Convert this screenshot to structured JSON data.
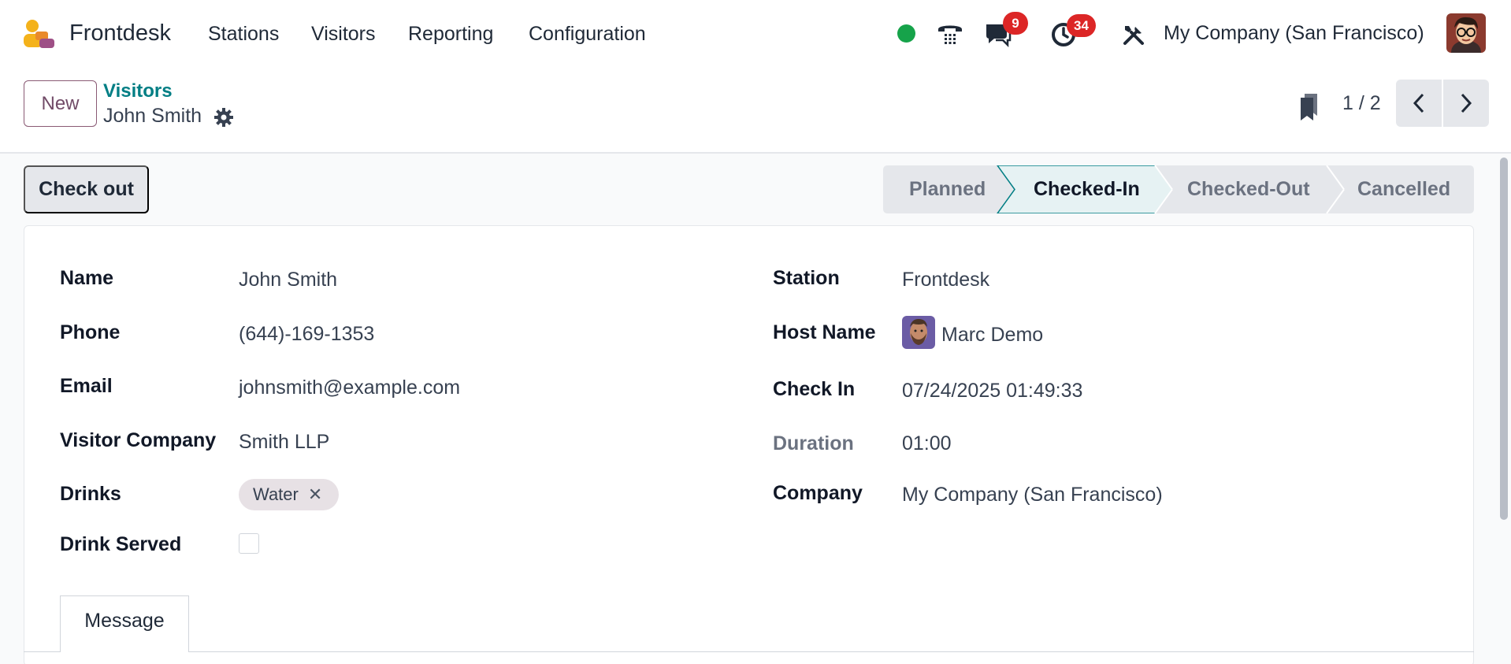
{
  "navbar": {
    "app_name": "Frontdesk",
    "menus": [
      "Stations",
      "Visitors",
      "Reporting",
      "Configuration"
    ],
    "messages_badge": "9",
    "activities_badge": "34",
    "company": "My Company (San Francisco)"
  },
  "control_panel": {
    "new_label": "New",
    "breadcrumb": "Visitors",
    "record_title": "John Smith",
    "pager": "1 / 2"
  },
  "statusbar": {
    "checkout_label": "Check out",
    "stages": [
      "Planned",
      "Checked-In",
      "Checked-Out",
      "Cancelled"
    ],
    "active_stage": "Checked-In"
  },
  "form": {
    "left": [
      {
        "label": "Name",
        "value": "John Smith"
      },
      {
        "label": "Phone",
        "value": "(644)-169-1353"
      },
      {
        "label": "Email",
        "value": "johnsmith@example.com"
      },
      {
        "label": "Visitor Company",
        "value": "Smith LLP"
      },
      {
        "label": "Drinks",
        "value": "Water"
      },
      {
        "label": "Drink Served",
        "value": ""
      }
    ],
    "right": [
      {
        "label": "Station",
        "value": "Frontdesk"
      },
      {
        "label": "Host Name",
        "value": "Marc Demo"
      },
      {
        "label": "Check In",
        "value": "07/24/2025 01:49:33"
      },
      {
        "label": "Duration",
        "value": "01:00"
      },
      {
        "label": "Company",
        "value": "My Company (San Francisco)"
      }
    ]
  },
  "tabs": [
    "Message"
  ],
  "colors": {
    "brand": "#714b67",
    "link": "#017e84",
    "online": "#16a34a",
    "badge": "#dc2626"
  }
}
